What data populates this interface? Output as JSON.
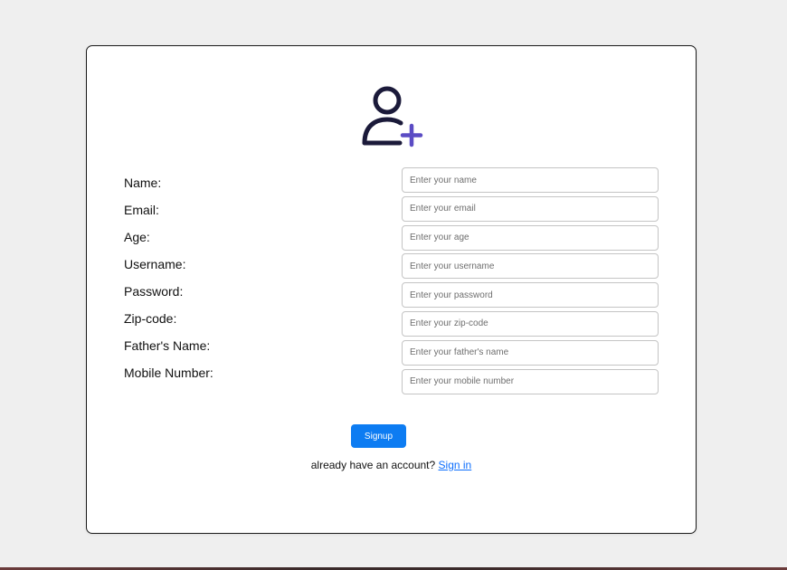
{
  "form": {
    "icon": "user-plus-icon",
    "colors": {
      "icon_stroke": "#1b1a3a",
      "icon_plus": "#5b4cc4",
      "button_bg": "#0d7cf2",
      "link": "#0d6efd"
    },
    "fields": [
      {
        "label": "Name:",
        "placeholder": "Enter your name",
        "value": ""
      },
      {
        "label": "Email:",
        "placeholder": "Enter your email",
        "value": ""
      },
      {
        "label": "Age:",
        "placeholder": "Enter your age",
        "value": ""
      },
      {
        "label": "Username:",
        "placeholder": "Enter your username",
        "value": ""
      },
      {
        "label": "Password:",
        "placeholder": "Enter your password",
        "value": ""
      },
      {
        "label": "Zip-code:",
        "placeholder": "Enter your zip-code",
        "value": ""
      },
      {
        "label": "Father's Name:",
        "placeholder": "Enter your father's name",
        "value": ""
      },
      {
        "label": "Mobile Number:",
        "placeholder": "Enter your mobile number",
        "value": ""
      }
    ],
    "submit_label": "Signup",
    "signin_prompt": "already have an account?",
    "signin_link": "Sign in"
  }
}
